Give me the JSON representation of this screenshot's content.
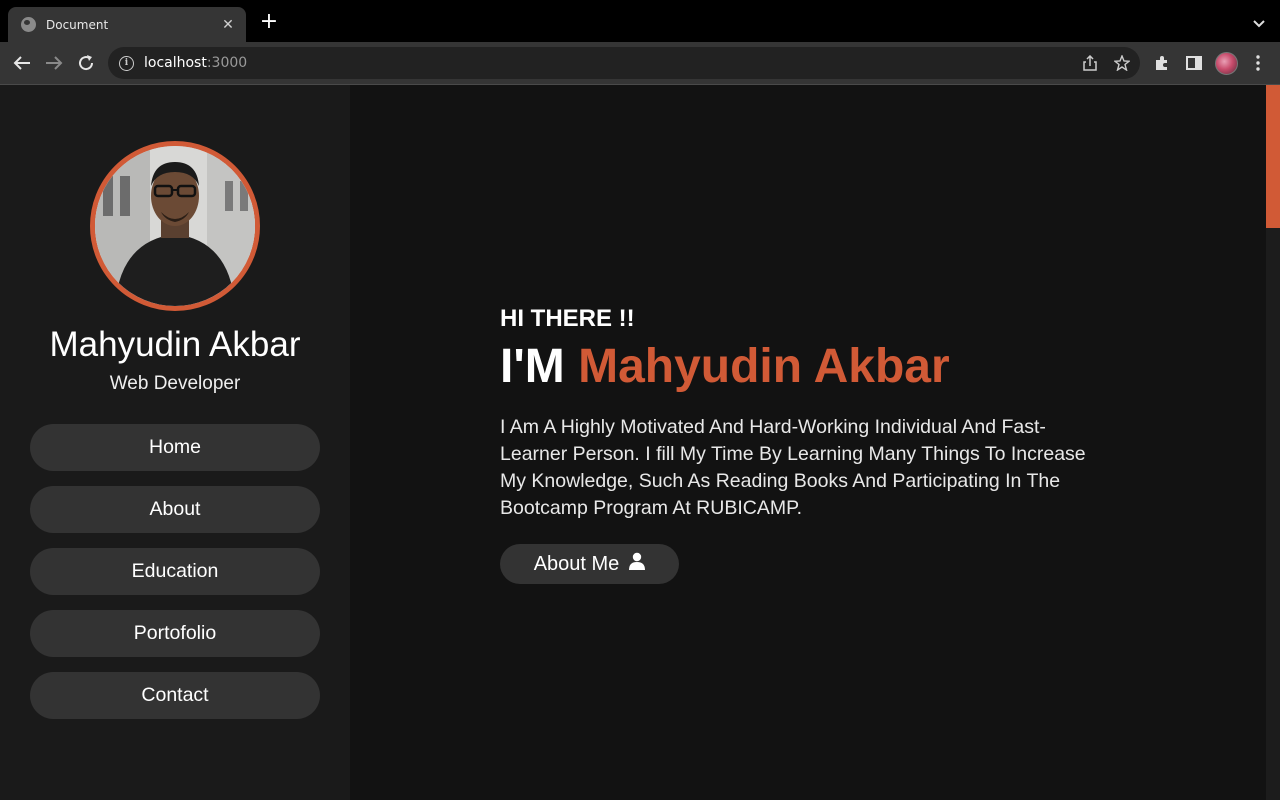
{
  "browser": {
    "tab_title": "Document",
    "tab_close": "✕",
    "new_tab": "+",
    "url_host": "localhost",
    "url_port": ":3000"
  },
  "colors": {
    "accent": "#d15a36",
    "sidebar_bg": "#1a1a1a",
    "main_bg": "#121212",
    "button_bg": "#333333"
  },
  "sidebar": {
    "name": "Mahyudin Akbar",
    "role": "Web Developer",
    "nav": [
      {
        "label": "Home"
      },
      {
        "label": "About"
      },
      {
        "label": "Education"
      },
      {
        "label": "Portofolio"
      },
      {
        "label": "Contact"
      }
    ]
  },
  "hero": {
    "greeting": "HI THERE !!",
    "prefix": "I'M",
    "name": "Mahyudin Akbar",
    "intro": "I Am A Highly Motivated And Hard-Working Individual And Fast-Learner Person. I fill My Time By Learning Many Things To Increase My Knowledge, Such As Reading Books And Participating In The Bootcamp Program At RUBICAMP.",
    "button_label": "About Me",
    "button_icon": "user-icon"
  }
}
